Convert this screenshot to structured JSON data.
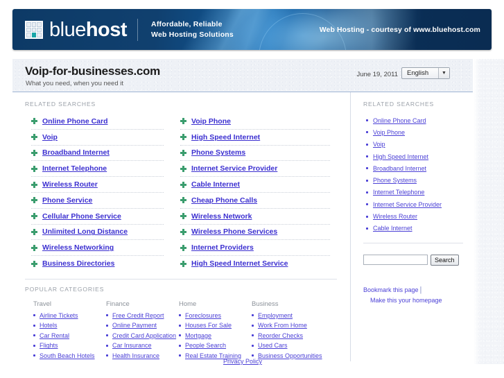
{
  "banner": {
    "logo_text_light": "blue",
    "logo_text_bold": "host",
    "tagline_line1": "Affordable, Reliable",
    "tagline_line2": "Web Hosting Solutions",
    "right_text": "Web Hosting - courtesy of www.bluehost.com",
    "grid_icon": "grid-icon"
  },
  "titlebar": {
    "site_title": "Voip-for-businesses.com",
    "subtitle": "What you need, when you need it",
    "date": "June 19, 2011",
    "language_selected": "English",
    "language_caret": "▼"
  },
  "main": {
    "related_searches_heading": "RELATED SEARCHES",
    "related_left": [
      "Online Phone Card",
      "Voip",
      "Broadband Internet",
      "Internet Telephone",
      "Wireless Router",
      "Phone Service",
      "Cellular Phone Service",
      "Unlimited Long Distance",
      "Wireless Networking",
      "Business Directories"
    ],
    "related_right": [
      "Voip Phone",
      "High Speed Internet",
      "Phone Systems",
      "Internet Service Provider",
      "Cable Internet",
      "Cheap Phone Calls",
      "Wireless Network",
      "Wireless Phone Services",
      "Internet Providers",
      "High Speed Internet Service"
    ],
    "popular_heading": "POPULAR CATEGORIES",
    "categories": [
      {
        "title": "Travel",
        "links": [
          "Airline Tickets",
          "Hotels",
          "Car Rental",
          "Flights",
          "South Beach Hotels"
        ]
      },
      {
        "title": "Finance",
        "links": [
          "Free Credit Report",
          "Online Payment",
          "Credit Card Application",
          "Car Insurance",
          "Health Insurance"
        ]
      },
      {
        "title": "Home",
        "links": [
          "Foreclosures",
          "Houses For Sale",
          "Mortgage",
          "People Search",
          "Real Estate Training"
        ]
      },
      {
        "title": "Business",
        "links": [
          "Employment",
          "Work From Home",
          "Reorder Checks",
          "Used Cars",
          "Business Opportunities"
        ]
      }
    ]
  },
  "sidebar": {
    "heading": "RELATED SEARCHES",
    "links": [
      "Online Phone Card",
      "Voip Phone",
      "Voip",
      "High Speed Internet",
      "Broadband Internet",
      "Phone Systems",
      "Internet Telephone",
      "Internet Service Provider",
      "Wireless Router",
      "Cable Internet"
    ],
    "search_value": "",
    "search_placeholder": "",
    "search_button": "Search",
    "bookmark_link": "Bookmark this page",
    "bookmark_separator": "|",
    "homepage_link": "Make this your homepage"
  },
  "footer": {
    "privacy_policy": "Privacy Policy"
  },
  "colors": {
    "banner_dark_blue": "#0a2e56",
    "banner_bright_blue": "#0e5fa5",
    "link_purple": "#4a3fd6",
    "related_link_blue": "#3b2fd0",
    "plus_green": "#3b9d6e",
    "heading_gray": "#9aa0a8"
  }
}
